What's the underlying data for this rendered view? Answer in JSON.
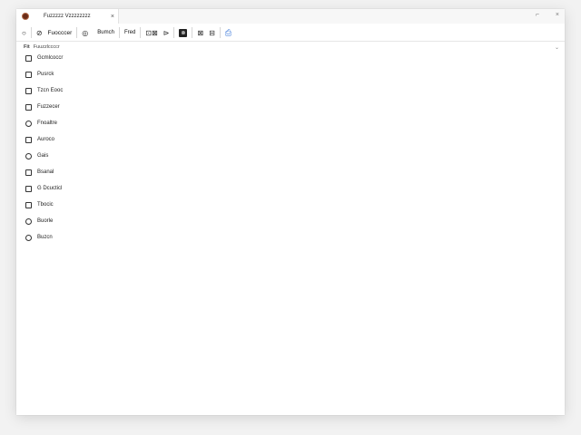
{
  "window": {
    "tab_title": "Fuzzzzz Vzzzzzzzz",
    "tab_close": "×",
    "controls": {
      "minimize": "⌐",
      "close": "×"
    }
  },
  "toolbar": {
    "circle_icon": "○",
    "browser_icon": "⊘",
    "browser_label": "Fuocccer",
    "item2_icon": "◎",
    "item2_label": "Bumch",
    "item3_label": "Fred",
    "item4_icon": "⊡⊠",
    "item4_icon2": "⊳",
    "active_icon": "⊗",
    "item6_icon": "⊠",
    "item6_icon2": "⊟",
    "blue_icon": "⎙"
  },
  "subheader": {
    "prefix": "Fit",
    "title": "Fuuzzlccccr",
    "caret": "⌄"
  },
  "list": {
    "items": [
      {
        "label": "Gcmlcoccr"
      },
      {
        "label": "Pusrck"
      },
      {
        "label": "Tzcn Eooc"
      },
      {
        "label": "Fuzzecer"
      },
      {
        "label": "Fnoaltre"
      },
      {
        "label": "Auroco"
      },
      {
        "label": "Gais"
      },
      {
        "label": "Bsanal"
      },
      {
        "label": "G Dcucticl"
      },
      {
        "label": "Tbocic"
      },
      {
        "label": "Buorle"
      },
      {
        "label": "Buzcn"
      }
    ]
  }
}
